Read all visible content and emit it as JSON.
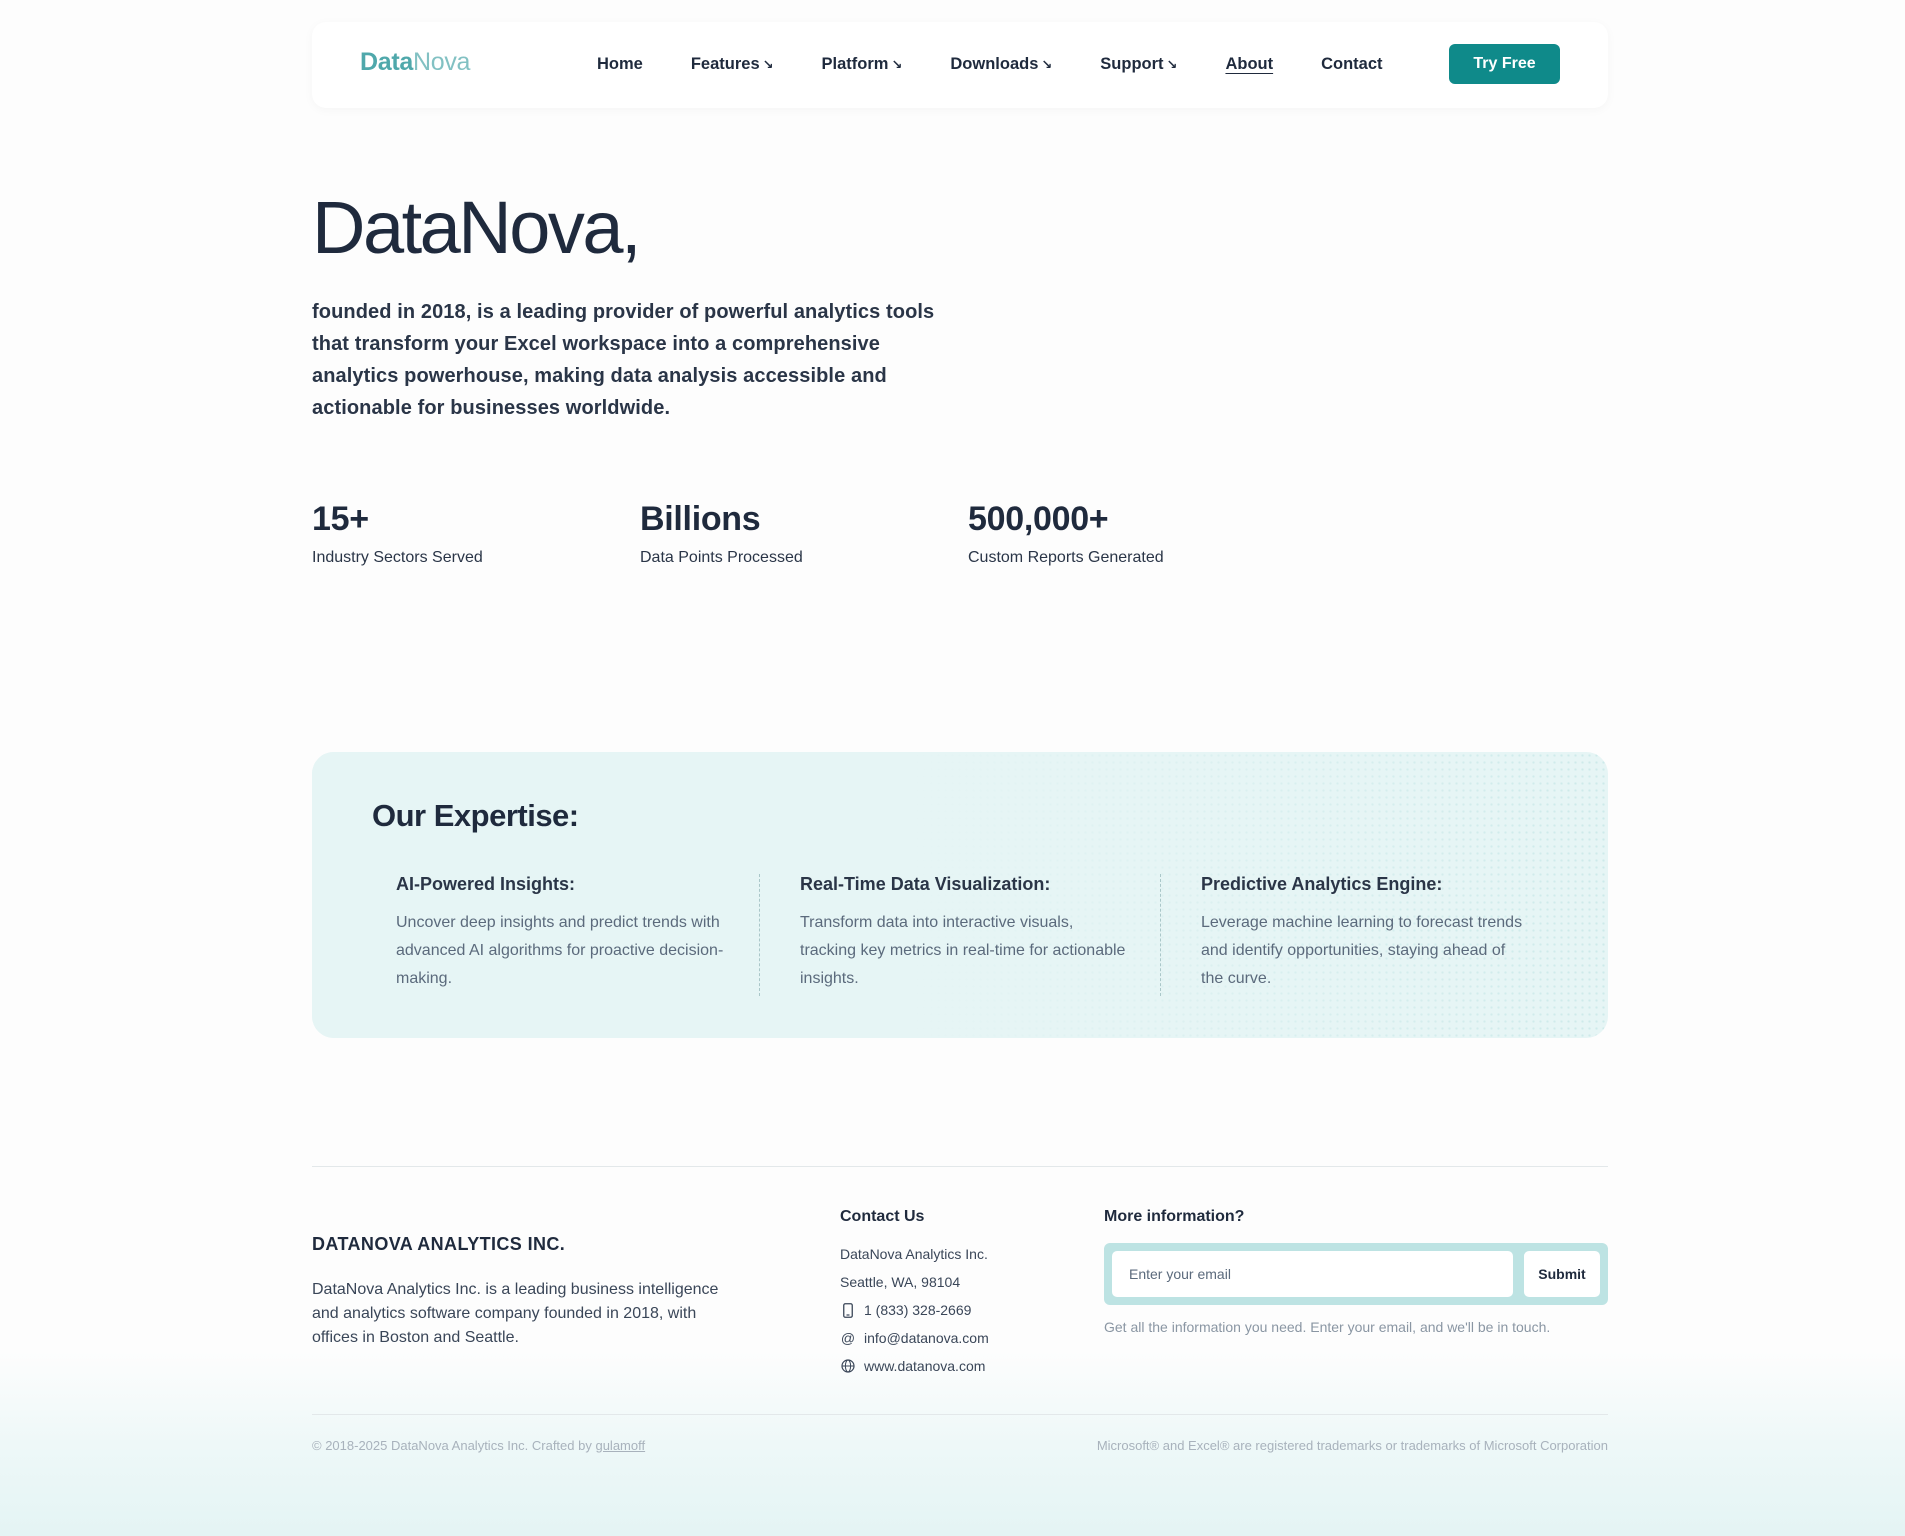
{
  "nav": {
    "logo_part1": "Data",
    "logo_part2": "Nova",
    "items": [
      {
        "label": "Home",
        "dropdown": false
      },
      {
        "label": "Features",
        "dropdown": true
      },
      {
        "label": "Platform",
        "dropdown": true
      },
      {
        "label": "Downloads",
        "dropdown": true
      },
      {
        "label": "Support",
        "dropdown": true
      },
      {
        "label": "About",
        "dropdown": false,
        "active": true
      },
      {
        "label": "Contact",
        "dropdown": false
      }
    ],
    "dropdown_arrow": "↘",
    "cta_label": "Try Free",
    "accent_color": "#0f8a8a"
  },
  "hero": {
    "title": "DataNova,",
    "text": "founded in 2018, is a leading provider of powerful analytics tools that transform your Excel workspace into a comprehensive analytics powerhouse, making data analysis accessible and actionable for businesses worldwide."
  },
  "stats": [
    {
      "value": "15+",
      "label": "Industry Sectors Served"
    },
    {
      "value": "Billions",
      "label": "Data Points Processed"
    },
    {
      "value": "500,000+",
      "label": "Custom Reports Generated"
    }
  ],
  "expertise": {
    "title": "Our Expertise:",
    "items": [
      {
        "heading": "AI-Powered Insights:",
        "text": "Uncover deep insights and predict trends with advanced AI algorithms for proactive decision-making."
      },
      {
        "heading": "Real-Time Data Visualization:",
        "text": "Transform data into interactive visuals, tracking key metrics in real-time for actionable insights."
      },
      {
        "heading": "Predictive Analytics Engine:",
        "text": "Leverage machine learning to forecast trends and identify opportunities, staying ahead of the curve."
      }
    ]
  },
  "footer": {
    "brand": "DATANOVA ANALYTICS INC.",
    "description": "DataNova Analytics Inc. is a leading business intelligence and analytics software company founded in 2018, with offices in Boston and Seattle.",
    "contact": {
      "title": "Contact Us",
      "company": "DataNova Analytics Inc.",
      "address": "Seattle, WA, 98104",
      "phone": "1 (833) 328-2669",
      "email": "info@datanova.com",
      "website": "www.datanova.com"
    },
    "subscribe": {
      "title": "More information?",
      "placeholder": "Enter your email",
      "button": "Submit",
      "note": "Get all the information you need. Enter your email, and we'll be in touch."
    },
    "copyright_prefix": "© 2018-2025 DataNova Analytics Inc. Crafted by",
    "copyright_link": "gulamoff",
    "trademark": "Microsoft® and Excel® are registered trademarks or trademarks of Microsoft Corporation"
  }
}
